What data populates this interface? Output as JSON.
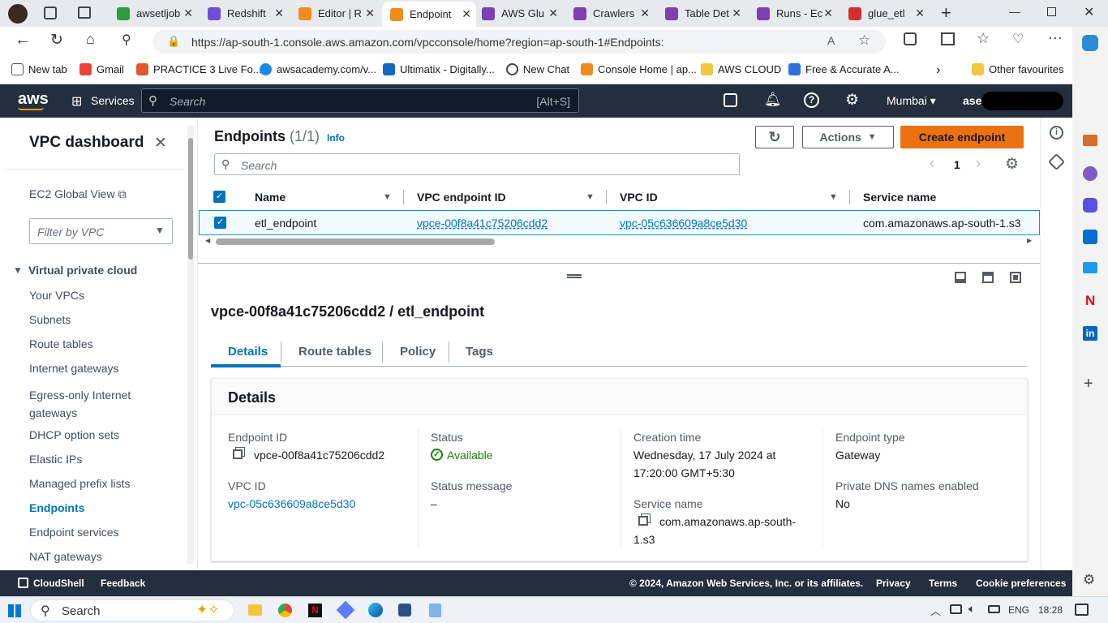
{
  "browser": {
    "tabs": [
      {
        "label": "awsetljob",
        "color": "#2b9e3e"
      },
      {
        "label": "Redshift",
        "color": "#6f4dd8"
      },
      {
        "label": "Editor | R",
        "color": "#f08c1e"
      },
      {
        "label": "Endpoint",
        "color": "#f08c1e"
      },
      {
        "label": "AWS Glu",
        "color": "#7d3fb2"
      },
      {
        "label": "Crawlers",
        "color": "#7d3fb2"
      },
      {
        "label": "Table Det",
        "color": "#7d3fb2"
      },
      {
        "label": "Runs - Ec",
        "color": "#7d3fb2"
      },
      {
        "label": "glue_etl",
        "color": "#d32f2f"
      }
    ],
    "url": "https://ap-south-1.console.aws.amazon.com/vpcconsole/home?region=ap-south-1#Endpoints:",
    "favorites": [
      "New tab",
      "Gmail",
      "PRACTICE 3 Live Fo...",
      "awsacademy.com/v...",
      "Ultimatix - Digitally...",
      "New Chat",
      "Console Home | ap...",
      "AWS CLOUD",
      "Free & Accurate A..."
    ],
    "other_favourites": "Other favourites"
  },
  "aws_header": {
    "logo": "aws",
    "services": "Services",
    "search_placeholder": "Search",
    "search_shortcut": "[Alt+S]",
    "region": "Mumbai",
    "user": "asee"
  },
  "sidebar": {
    "title": "VPC dashboard",
    "ec2_global": "EC2 Global View",
    "filter_placeholder": "Filter by VPC",
    "section": "Virtual private cloud",
    "items": [
      "Your VPCs",
      "Subnets",
      "Route tables",
      "Internet gateways",
      "Egress-only Internet gateways",
      "DHCP option sets",
      "Elastic IPs",
      "Managed prefix lists",
      "Endpoints",
      "Endpoint services",
      "NAT gateways"
    ],
    "active_item": "Endpoints"
  },
  "endpoints": {
    "title": "Endpoints",
    "count": "(1/1)",
    "info": "Info",
    "actions": "Actions",
    "create": "Create endpoint",
    "search_placeholder": "Search",
    "page": "1",
    "columns": [
      "Name",
      "VPC endpoint ID",
      "VPC ID",
      "Service name"
    ],
    "rows": [
      {
        "name": "etl_endpoint",
        "endpoint_id": "vpce-00f8a41c75206cdd2",
        "vpc_id": "vpc-05c636609a8ce5d30",
        "service": "com.amazonaws.ap-south-1.s3"
      }
    ]
  },
  "detail": {
    "heading": "vpce-00f8a41c75206cdd2 / etl_endpoint",
    "tabs": [
      "Details",
      "Route tables",
      "Policy",
      "Tags"
    ],
    "active_tab": "Details",
    "panel_title": "Details",
    "endpoint_id_label": "Endpoint ID",
    "endpoint_id": "vpce-00f8a41c75206cdd2",
    "vpc_id_label": "VPC ID",
    "vpc_id": "vpc-05c636609a8ce5d30",
    "status_label": "Status",
    "status": "Available",
    "status_msg_label": "Status message",
    "status_msg": "–",
    "creation_label": "Creation time",
    "creation_line1": "Wednesday, 17 July 2024 at",
    "creation_line2": "17:20:00 GMT+5:30",
    "service_label": "Service name",
    "service_line1": "com.amazonaws.ap-south-",
    "service_line2": "1.s3",
    "type_label": "Endpoint type",
    "type": "Gateway",
    "dns_label": "Private DNS names enabled",
    "dns": "No"
  },
  "footer": {
    "cloudshell": "CloudShell",
    "feedback": "Feedback",
    "copyright": "© 2024, Amazon Web Services, Inc. or its affiliates.",
    "privacy": "Privacy",
    "terms": "Terms",
    "cookie": "Cookie preferences"
  },
  "taskbar": {
    "search": "Search",
    "lang": "ENG",
    "time": "18:28"
  },
  "colors": {
    "aws_dark": "#232f3e",
    "orange": "#ff9900",
    "link": "#0073bb",
    "success": "#1d8102"
  }
}
